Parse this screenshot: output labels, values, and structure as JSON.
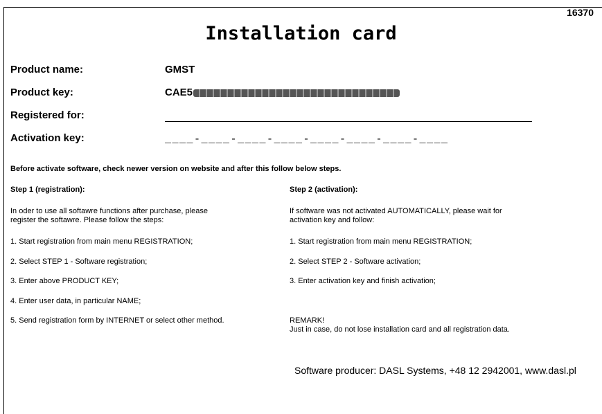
{
  "card_number": "16370",
  "title": "Installation card",
  "fields": {
    "product_name_label": "Product name:",
    "product_name_value": "GMST",
    "product_key_label": "Product key:",
    "product_key_prefix": "CAE5",
    "registered_for_label": "Registered for:",
    "activation_key_label": "Activation key:",
    "activation_key_value": "____-____-____-____-____-____-____-____"
  },
  "intro": "Before activate software, check newer version on website and after this follow below steps.",
  "step1": {
    "heading": "Step 1 (registration):",
    "para_line1": "In oder to use all softawre functions after purchase, please",
    "para_line2": "register the softawre. Please follow the steps:",
    "items": [
      "1. Start registration from main menu REGISTRATION;",
      "2. Select STEP 1 - Software registration;",
      "3. Enter above PRODUCT KEY;",
      "4. Enter user data, in particular NAME;",
      "5. Send registration form by INTERNET or select other method."
    ]
  },
  "step2": {
    "heading": "Step 2 (activation):",
    "para_line1": "If software was not activated AUTOMATICALLY, please wait for",
    "para_line2": "activation key and follow:",
    "items": [
      "1. Start registration from main menu REGISTRATION;",
      "2. Select STEP 2 - Software activation;",
      "3. Enter activation key and finish activation;"
    ],
    "remark_title": "REMARK!",
    "remark_text": "Just in case, do not lose installation card and all registration data."
  },
  "producer": "Software producer: DASL Systems, +48 12 2942001, www.dasl.pl"
}
